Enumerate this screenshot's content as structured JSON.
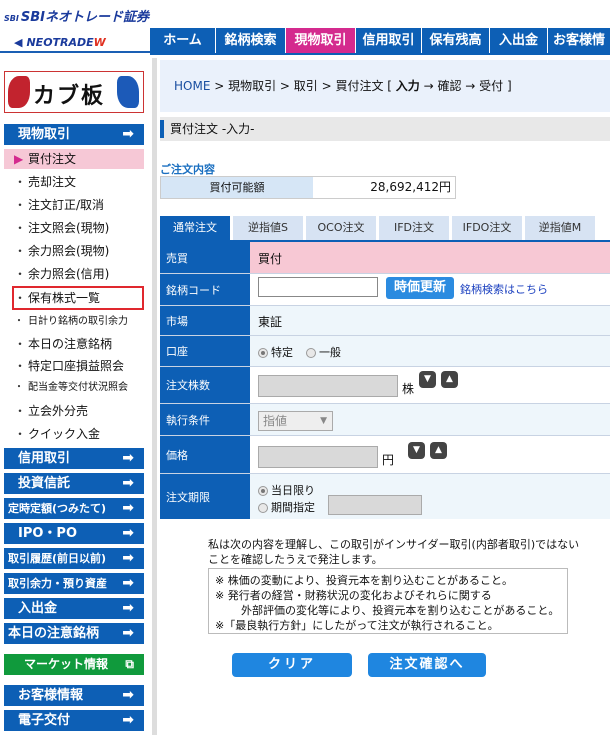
{
  "header": {
    "sbi_mark": "SBI",
    "brand": "SBIネオトレード証券",
    "neotrade": "NEOTRADE",
    "neotrade_w": "W",
    "nav": [
      "ホーム",
      "銘柄検索",
      "現物取引",
      "信用取引",
      "保有残高",
      "入出金",
      "お客様情"
    ],
    "active_nav": "現物取引"
  },
  "sidebar": {
    "logo_text": "カブ板",
    "sections": {
      "spot": "現物取引",
      "margin": "信用取引",
      "trust": "投資信託",
      "tsumitate": "定時定額(つみたて)",
      "ipo": "IPO・PO",
      "history": "取引履歴(前日以前)",
      "balance": "取引余力・預り資産",
      "deposit": "入出金",
      "today_notice": "本日の注意銘柄",
      "market": "マーケット情報",
      "customer": "お客様情報",
      "e_delivery": "電子交付"
    },
    "items": [
      "買付注文",
      "売却注文",
      "注文訂正/取消",
      "注文照会(現物)",
      "余力照会(現物)",
      "余力照会(信用)",
      "保有株式一覧",
      "日計り銘柄の取引余力",
      "本日の注意銘柄",
      "特定口座損益照会",
      "配当金等交付状況照会",
      "立会外分売",
      "クイック入金"
    ],
    "arrow": "➡",
    "bullet": "・",
    "active_bullet": "▶"
  },
  "breadcrumb": {
    "home": "HOME",
    "rest": " > 現物取引 > 取引 > 買付注文 [ ",
    "input": "入力",
    "tail": " → 確認 → 受付 ]"
  },
  "section_title": "買付注文 -入力-",
  "order_content_label": "ご注文内容",
  "available": {
    "label": "買付可能額",
    "value": "28,692,412",
    "unit": "円"
  },
  "tabs": [
    "通常注文",
    "逆指値S",
    "OCO注文",
    "IFD注文",
    "IFDO注文",
    "逆指値M"
  ],
  "form": {
    "trade_label": "売買",
    "trade_value": "買付",
    "code_label": "銘柄コード",
    "code_value": "",
    "update_button": "時価更新",
    "search_link": "銘柄検索はこちら",
    "market_label": "市場",
    "market_value": "東証",
    "account_label": "口座",
    "account_options": [
      "特定",
      "一般"
    ],
    "qty_label": "注文株数",
    "qty_unit": "株",
    "exec_label": "執行条件",
    "exec_value": "指値",
    "price_label": "価格",
    "price_unit": "円",
    "term_label": "注文期限",
    "term_options": [
      "当日限り",
      "期間指定"
    ],
    "step_down": "▼",
    "step_up": "▲",
    "caret": "▼"
  },
  "notice": {
    "statement": "私は次の内容を理解し、この取引がインサイダー取引(内部者取引)ではないことを確認したうえで発注します。",
    "lines": [
      "※ 株価の変動により、投資元本を割り込むことがあること。",
      "※ 発行者の経営・財務状況の変化およびそれらに関する",
      "外部評価の変化等により、投資元本を割り込むことがあること。",
      "※「最良執行方針」にしたがって注文が執行されること。"
    ]
  },
  "actions": {
    "clear": "クリア",
    "confirm": "注文確認へ"
  },
  "colors": {
    "primary": "#0d5fb5",
    "accent_pink": "#d42a8e",
    "market_green": "#109a3c",
    "highlight_red": "#e0282e"
  }
}
